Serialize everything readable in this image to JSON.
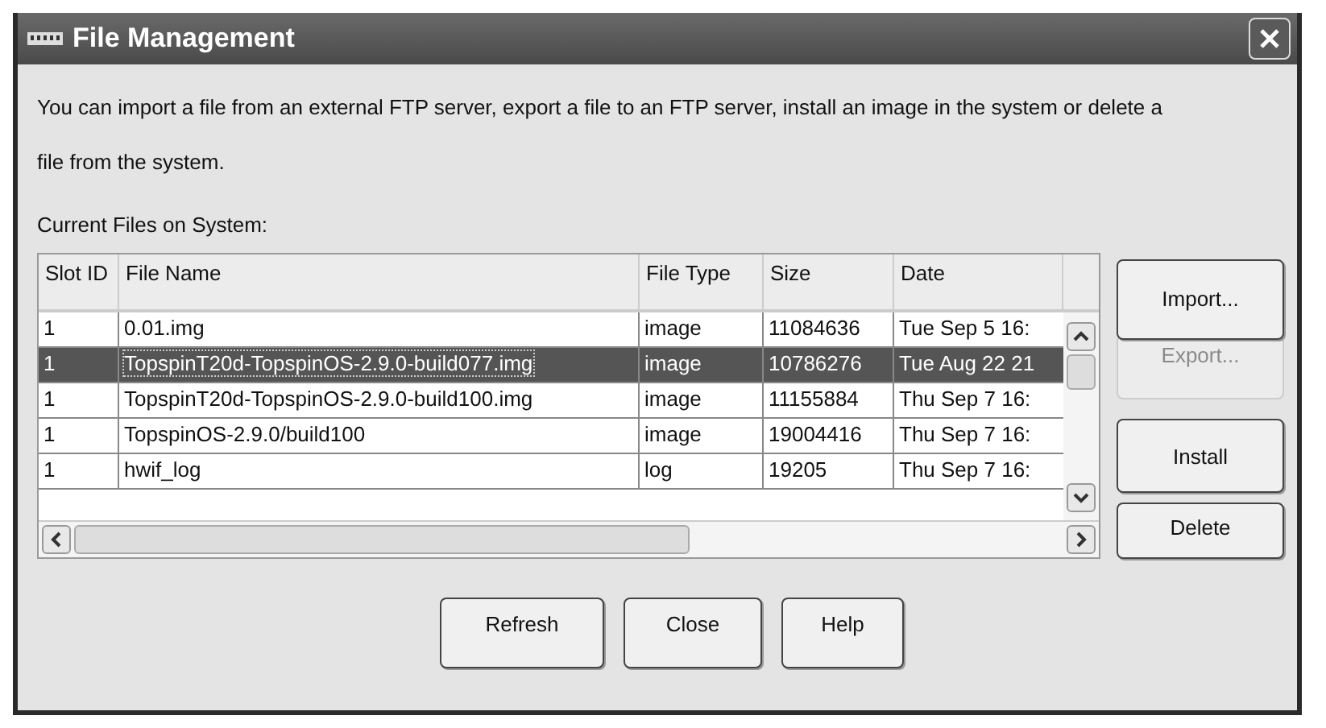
{
  "window": {
    "title": "File Management"
  },
  "description": "You can import a file from an external FTP server, export a file to an FTP server, install an image in the system or delete a file from the system.",
  "table_label": "Current Files on System:",
  "table": {
    "columns": [
      "Slot ID",
      "File Name",
      "File Type",
      "Size",
      "Date"
    ],
    "rows": [
      {
        "cells": [
          "1",
          "0.01.img",
          "image",
          "11084636",
          "Tue Sep  5 16:"
        ],
        "selected": false
      },
      {
        "cells": [
          "1",
          "TopspinT20d-TopspinOS-2.9.0-build077.img",
          "image",
          "10786276",
          "Tue Aug 22 21"
        ],
        "selected": true
      },
      {
        "cells": [
          "1",
          "TopspinT20d-TopspinOS-2.9.0-build100.img",
          "image",
          "11155884",
          "Thu Sep  7 16:"
        ],
        "selected": false
      },
      {
        "cells": [
          "1",
          "TopspinOS-2.9.0/build100",
          "image",
          "19004416",
          "Thu Sep  7 16:"
        ],
        "selected": false
      },
      {
        "cells": [
          "1",
          "hwif_log",
          "log",
          "19205",
          "Thu Sep  7 16:"
        ],
        "selected": false
      }
    ]
  },
  "side_buttons": [
    {
      "label": "Import...",
      "disabled": false
    },
    {
      "label": "Export...",
      "disabled": true
    },
    {
      "label": "Install",
      "disabled": false
    },
    {
      "label": "Delete",
      "disabled": false
    }
  ],
  "buttons": [
    "Refresh",
    "Close",
    "Help"
  ]
}
